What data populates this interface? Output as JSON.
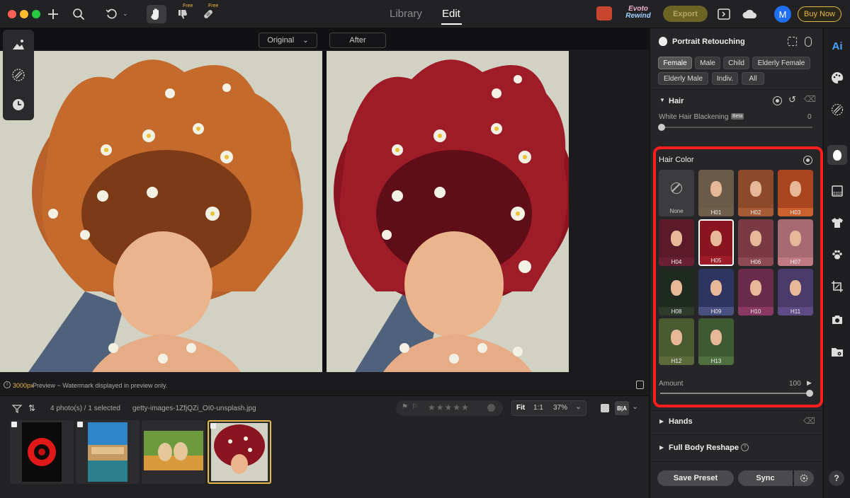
{
  "topbar": {
    "free_label": "Free",
    "free_label2": "Free",
    "library_tab": "Library",
    "edit_tab": "Edit",
    "rewind_line1": "Evoto",
    "rewind_line2": "Rewind",
    "export_label": "Export",
    "avatar_letter": "M",
    "buy_label": "Buy Now"
  },
  "view": {
    "original_label": "Original",
    "after_label": "After"
  },
  "status": {
    "resolution": "3000px",
    "message": " Preview ~ Watermark displayed in preview only."
  },
  "filmstrip": {
    "count_text": "4 photo(s) / 1 selected",
    "filename": "getty-images-1ZfjQZi_OI0-unsplash.jpg",
    "fit_label": "Fit",
    "ratio_label": "1:1",
    "zoom_label": "37%",
    "ba_label": "B|A"
  },
  "panel": {
    "title": "Portrait Retouching",
    "presets": [
      "Female",
      "Male",
      "Child",
      "Elderly Female",
      "Elderly Male",
      "Indiv.",
      "All"
    ],
    "hair_section": "Hair",
    "white_hair_label": "White Hair Blackening",
    "beta_badge": "Beta",
    "white_hair_value": "0",
    "hair_color_title": "Hair Color",
    "swatches": [
      "None",
      "H01",
      "H02",
      "H03",
      "H04",
      "H05",
      "H06",
      "H07",
      "H08",
      "H09",
      "H10",
      "H11",
      "H12",
      "H13"
    ],
    "selected_swatch": "H05",
    "amount_label": "Amount",
    "amount_value": "100",
    "hands_label": "Hands",
    "full_body_label": "Full Body Reshape",
    "save_preset": "Save Preset",
    "sync": "Sync"
  },
  "rail": {
    "ai_label": "Ai",
    "help_label": "?"
  },
  "colors": {
    "accent_yellow": "#e6b84a",
    "highlight_red": "#ff1e1e",
    "hair_original": "#b8612a",
    "hair_after": "#8a1420"
  }
}
